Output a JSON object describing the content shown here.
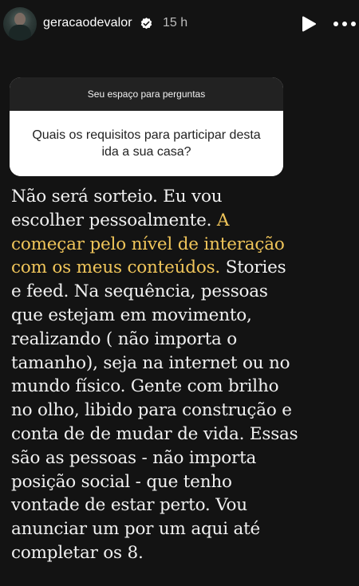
{
  "header": {
    "username": "geracaodevalor",
    "time": "15 h",
    "avatar_icon": "profile-photo",
    "verified_icon": "verified-badge-icon",
    "play_icon": "play-icon",
    "more_icon": "more-icon"
  },
  "question": {
    "title": "Seu espaço para perguntas",
    "text": "Quais os requisitos para participar desta ida a sua casa?"
  },
  "answer": {
    "part1": "Não será sorteio. Eu vou escolher pessoalmente. ",
    "highlight": "A começar pelo nível de interação com os meus conteúdos.",
    "part2": " Stories e feed. Na sequência, pessoas que estejam em movimento, realizando ( não importa o tamanho), seja na internet ou no mundo físico. Gente com brilho no olho, libido para construção e conta de de mudar de vida. Essas são as pessoas - não importa posição social - que tenho vontade de estar perto. Vou anunciar um por um aqui até completar os 8."
  },
  "colors": {
    "background": "#131313",
    "highlight": "#f0c55a",
    "card_header": "#222222",
    "verified": "#ffffff"
  }
}
